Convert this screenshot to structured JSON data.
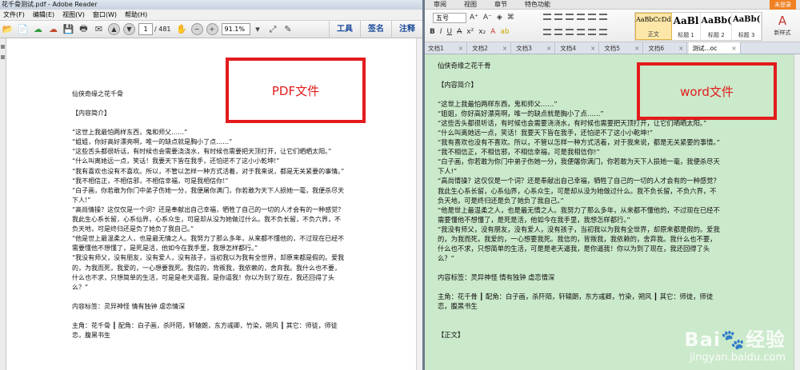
{
  "pdf": {
    "window_title": "花千骨测试.pdf - Adobe Reader",
    "menu": [
      "文件(F)",
      "编辑(E)",
      "视图(V)",
      "窗口(W)",
      "帮助(H)"
    ],
    "toolbar": {
      "current_page": "1",
      "total_pages": "/ 481",
      "zoom": "91.1%",
      "tools_label": "工具",
      "sign_label": "签名",
      "comment_label": "注释"
    },
    "label": "PDF文件",
    "paragraphs": [
      "仙侠奇缘之花千骨",
      "",
      "【内容简介】",
      "",
      "“这世上我最怕两样东西，鬼和师父……”",
      "“姐姐，你好高好漂亮啊，唯一的缺点就是胸小了点……”",
      "“这些舌头都很听话，有时候也会需要浇浇水，有时候也需要把天顶打开，让它们晒晒太阳。”",
      "“什么叫离她远一点，笑话！我要天下皆在我手，还怕逆不了这小小乾坤!”",
      "“我有喜欢也没有不喜欢。所以，不管以怎样一种方式活着，对于我来说，都是无关紧要的事情。”",
      "“我不相信正，不相信邪，不相信幸福，可是我相信你!”",
      "“白子画，你若敢为你门中弟子伤她一分，我便屠你满门，你若敢为天下人损她一毫，我便杀尽天下人!”",
      "“高尚情操？这仅仅是一个词？还是奉献出自己幸福，牺牲了自己的一切的人才会有的一种感觉？我此生心系长留，心系仙界，心系众生，可是却从没为她做过什么。我不负长留，不负六界，不负天地，可是终归还是负了她负了我自己。”",
      "“他是世上最温柔之人，也是最无情之人。我努力了那么多年，从来都不懂他的，不过现在已经不需要懂他不想懂了，是死是活，他如今在我手里，我想怎样都行。”",
      "“我没有师父，没有朋友，没有爱人，没有孩子，当初我以为我有全世界，却原来都是假的。爱我的，为我而死，我爱的，一心想要我死。我信的，背叛我，我依赖的，舍弃我。我什么也不要，什么也不求，只想简单的生活，可是是老天逼我，是你逼我！你以为到了现在，我还回得了头么？”",
      "",
      "内容标签：灵异神怪 情有独钟 虐恋情深",
      "",
      "主角：花千骨 ┃ 配角：白子画，杀阡陌，轩辕朗，东方彧卿，竹染，朔风 ┃ 其它：师徒，师徒恋，腹黑书生"
    ]
  },
  "wps": {
    "ribbon_tabs": [
      "审阅",
      "视图",
      "章节",
      "特色功能"
    ],
    "login_label": "未登录",
    "font_size": "五号",
    "styles": [
      {
        "sample": "AaBbCcDd",
        "name": "正文"
      },
      {
        "sample": "AaBl",
        "name": "标题 1"
      },
      {
        "sample": "AaBb(",
        "name": "标题 2"
      },
      {
        "sample": "AaBb(",
        "name": "标题 3"
      }
    ],
    "new_style_label": "新样式",
    "doc_tabs": [
      "文档1",
      "文档2",
      "文档3",
      "文档4",
      "文档5",
      "文档6",
      "测试...oc"
    ],
    "label": "word文件",
    "paragraphs": [
      "仙侠奇缘之花千骨",
      "",
      "【内容简介】",
      "",
      "“这世上我最怕两样东西，鬼和师父……”",
      "“姐姐，你好高好漂亮啊，唯一的缺点就是胸小了点……”",
      "“这些舌头都很听话，有时候也会需要浇浇水，有时候也需要把天顶打开，让它们晒晒太阳。”",
      "“什么叫离她远一点，笑话！我要天下皆在我手，还怕逆不了这小小乾坤!”",
      "“我有喜欢也没有不喜欢。所以，不管以怎样一种方式活着，对于我来说，都是无关紧要的事情。”",
      "“我不相信正，不相信邪，不相信幸福，可是我相信你!”",
      "“白子画，你若敢为你门中弟子伤她一分，我便屠你满门，你若敢为天下人损她一毫，我便杀尽天下人!”",
      "“高尚情操？这仅仅是一个词？还是奉献出自己幸福，牺牲了自己的一切的人才会有的一种感觉？我此生心系长留，心系仙界，心系众生，可是却从没为她做过什么。我不负长留，不负六界，不负天地，可是终归还是负了她负了我自己。”",
      "“他是世上最温柔之人，也是最无情之人。我努力了那么多年，从来都不懂他的，不过现在已经不需要懂他不想懂了，是死是活，他如今在我手里，我想怎样都行。”",
      "“我没有师父，没有朋友，没有爱人，没有孩子，当初我以为我有全世界，却原来都是假的。爱我的，为我而死，我爱的，一心想要我死。我信的，背叛我，我依赖的，舍弃我。我什么也不要，什么也不求，只想简单的生活，可是是老天逼我，是你逼我！你以为到了现在，我还回得了头么？”",
      "",
      "内容标签：灵异神怪 情有独钟 虐恋情深",
      "",
      "主角：花千骨 ┃ 配角：白子画，杀阡陌，轩辕朗，东方彧卿，竹染，朔风 ┃ 其它：师徒，师徒恋，腹黑书生",
      "",
      "",
      "【正文】"
    ]
  },
  "watermark": {
    "logo": "Bai🐾经验",
    "url": "jingyan.baidu.com"
  },
  "colors": {
    "label_red": "#e31b1b",
    "word_page_bg": "#cbe9cb",
    "wps_login": "#f08123"
  }
}
